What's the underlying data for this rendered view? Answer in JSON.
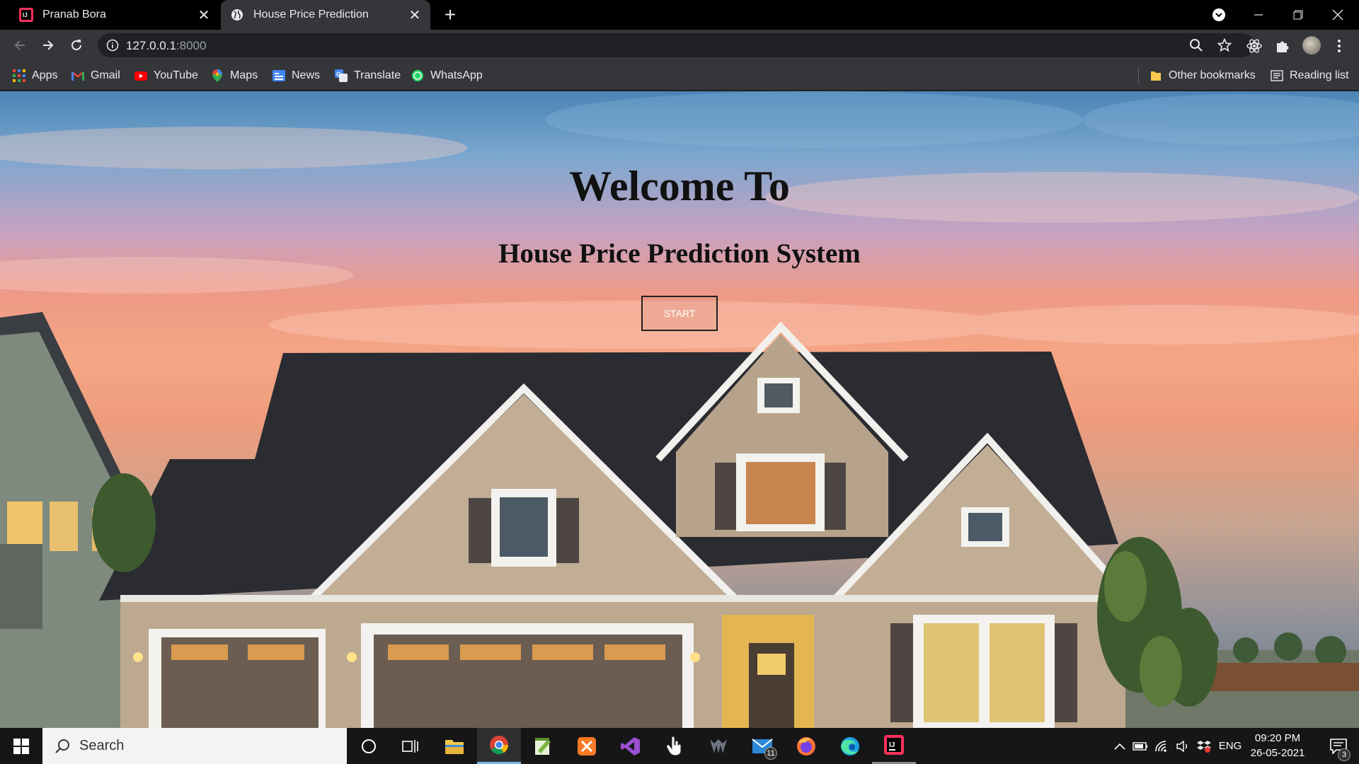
{
  "browser": {
    "tabs": [
      {
        "title": "Pranab Bora",
        "active": false
      },
      {
        "title": "House Price Prediction",
        "active": true
      }
    ],
    "url_host": "127.0.0.1",
    "url_port": ":8000",
    "bookmarks": [
      {
        "label": "Apps",
        "icon": "apps-grid-icon"
      },
      {
        "label": "Gmail",
        "icon": "gmail-icon"
      },
      {
        "label": "YouTube",
        "icon": "youtube-icon"
      },
      {
        "label": "Maps",
        "icon": "maps-icon"
      },
      {
        "label": "News",
        "icon": "news-icon"
      },
      {
        "label": "Translate",
        "icon": "translate-icon"
      },
      {
        "label": "WhatsApp",
        "icon": "whatsapp-icon"
      }
    ],
    "other_bookmarks": "Other bookmarks",
    "reading_list": "Reading list"
  },
  "page": {
    "welcome": "Welcome To",
    "subtitle": "House Price Prediction System",
    "start_button": "START"
  },
  "taskbar": {
    "search_placeholder": "Search",
    "mail_badge": "11",
    "language": "ENG",
    "time": "09:20 PM",
    "date": "26-05-2021",
    "notification_count": "3"
  },
  "colors": {
    "tab_strip": "#000000",
    "toolbar": "#35363a",
    "omnibox": "#202124",
    "taskbar": "#161616"
  }
}
